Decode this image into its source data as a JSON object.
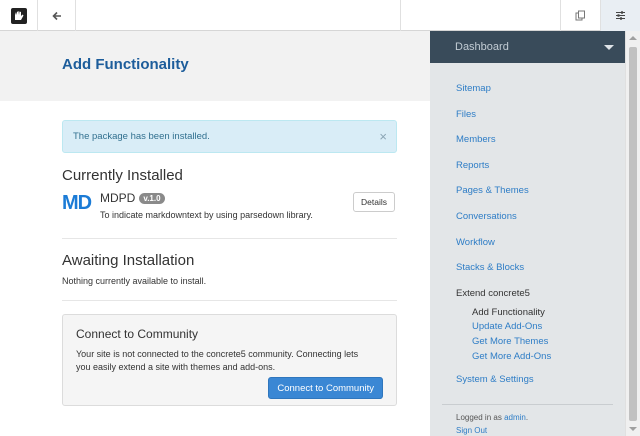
{
  "toolbar": {
    "logo_icon": "concrete5-hand-logo-icon",
    "back_icon": "arrow-left-icon",
    "search_icon": "search-icon",
    "search_value": "",
    "intelligent_search_icon": "copy-pages-icon",
    "settings_icon": "sliders-icon"
  },
  "page": {
    "title": "Add Functionality"
  },
  "alert": {
    "message": "The package has been installed.",
    "close": "×"
  },
  "installed": {
    "title": "Currently Installed",
    "package": {
      "icon_text": "MD",
      "name": "MDPD",
      "version": "v.1.0",
      "description": "To indicate markdowntext by using parsedown library.",
      "details_label": "Details"
    }
  },
  "awaiting": {
    "title": "Awaiting Installation",
    "empty_text": "Nothing currently available to install."
  },
  "community": {
    "title": "Connect to Community",
    "text": "Your site is not connected to the concrete5 community. Connecting lets you easily extend a site with themes and add-ons.",
    "button_label": "Connect to Community"
  },
  "panel": {
    "header": "Dashboard",
    "items": [
      {
        "label": "Sitemap"
      },
      {
        "label": "Files"
      },
      {
        "label": "Members"
      },
      {
        "label": "Reports"
      },
      {
        "label": "Pages & Themes"
      },
      {
        "label": "Conversations"
      },
      {
        "label": "Workflow"
      },
      {
        "label": "Stacks & Blocks"
      }
    ],
    "group": {
      "label": "Extend concrete5",
      "sub_items": [
        {
          "label": "Add Functionality",
          "active": true
        },
        {
          "label": "Update Add-Ons"
        },
        {
          "label": "Get More Themes"
        },
        {
          "label": "Get More Add-Ons"
        }
      ]
    },
    "after_item": "System & Settings",
    "logged_in_prefix": "Logged in as",
    "logged_in_user": "admin",
    "logged_in_suffix": ".",
    "sign_out": "Sign Out"
  },
  "colors": {
    "accent_blue": "#1d5d9b",
    "link_blue": "#2e7dc6",
    "panel_header": "#394b5a",
    "panel_bg": "#e3e6e8",
    "alert_bg": "#d9edf7"
  }
}
